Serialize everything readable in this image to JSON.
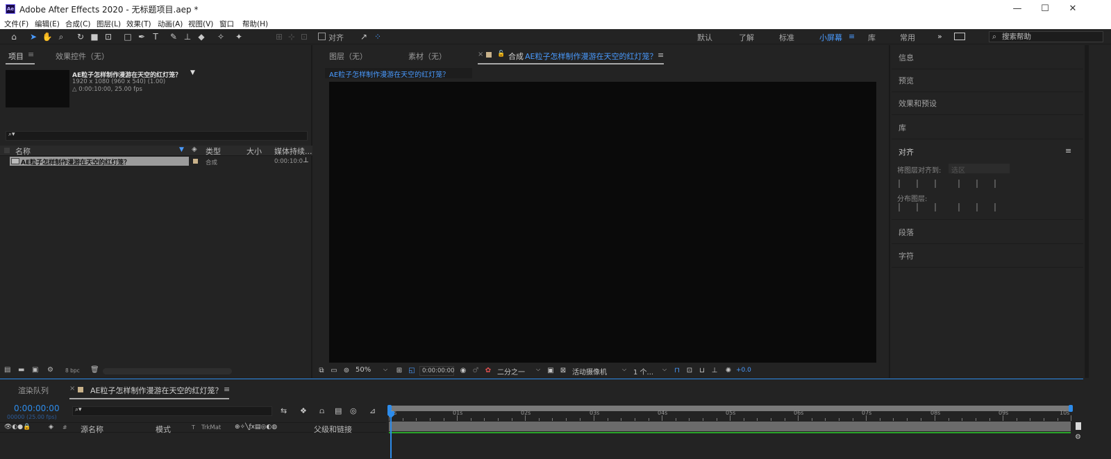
{
  "window": {
    "icon_label": "Ae",
    "title": "Adobe After Effects 2020 - 无标题项目.aep *"
  },
  "menu": [
    "文件(F)",
    "编辑(E)",
    "合成(C)",
    "图层(L)",
    "效果(T)",
    "动画(A)",
    "视图(V)",
    "窗口",
    "帮助(H)"
  ],
  "toolbar": {
    "align_label": "对齐",
    "workspaces": [
      "默认",
      "了解",
      "标准",
      "小屏幕",
      "库",
      "常用"
    ],
    "active_workspace": "小屏幕",
    "help_placeholder": "搜索帮助"
  },
  "project_panel": {
    "tab_project": "项目",
    "tab_effects": "效果控件（无）",
    "comp_name": "AE粒子怎样制作漫游在天空的红灯笼？",
    "comp_res": "1920 x 1080  (960 x 540) (1.00)",
    "comp_duration": "△ 0:00:10:00, 25.00 fps",
    "search_icon": "⌕▾",
    "columns": [
      "名称",
      "类型",
      "大小",
      "媒体持续..."
    ],
    "rows": [
      {
        "name": "AE粒子怎样制作漫游在天空的红灯笼？",
        "type": "合成",
        "size": "",
        "duration": "0:00:10:0"
      }
    ],
    "bpc": "8 bpc"
  },
  "viewer": {
    "tab_layer": "图层（无）",
    "tab_footage": "素材（无）",
    "tab_comp_prefix": "合成",
    "tab_comp_name": "AE粒子怎样制作漫游在天空的红灯笼？",
    "breadcrumb": "AE粒子怎样制作漫游在天空的红灯笼？",
    "zoom": "50%",
    "timecode": "0:00:00:00",
    "resolution": "二分之一",
    "camera": "活动摄像机",
    "views": "1 个...",
    "exposure": "+0.0"
  },
  "right_panel": {
    "items": [
      "信息",
      "预览",
      "效果和预设",
      "库"
    ],
    "align_title": "对齐",
    "align_to_label": "将图层对齐到:",
    "align_to_value": "选区",
    "distribute_label": "分布图层:",
    "bottom_items": [
      "段落",
      "字符"
    ]
  },
  "timeline": {
    "tab_render": "渲染队列",
    "tab_comp": "AE粒子怎样制作漫游在天空的红灯笼？",
    "current_time": "0:00:00:00",
    "frame_info": "00000 (25.00 fps)",
    "search_icon": "⌕▾",
    "columns": {
      "source": "源名称",
      "mode": "模式",
      "t": "T",
      "trkmat": "TrkMat",
      "parent": "父级和链接"
    },
    "ruler": [
      "0s",
      "01s",
      "02s",
      "03s",
      "04s",
      "05s",
      "06s",
      "07s",
      "08s",
      "09s",
      "10s"
    ]
  },
  "colors": {
    "accent": "#2d8ceb",
    "panel_bg": "#232323",
    "canvas": "#0a0a0a",
    "work_area_green": "#2aa52a"
  }
}
